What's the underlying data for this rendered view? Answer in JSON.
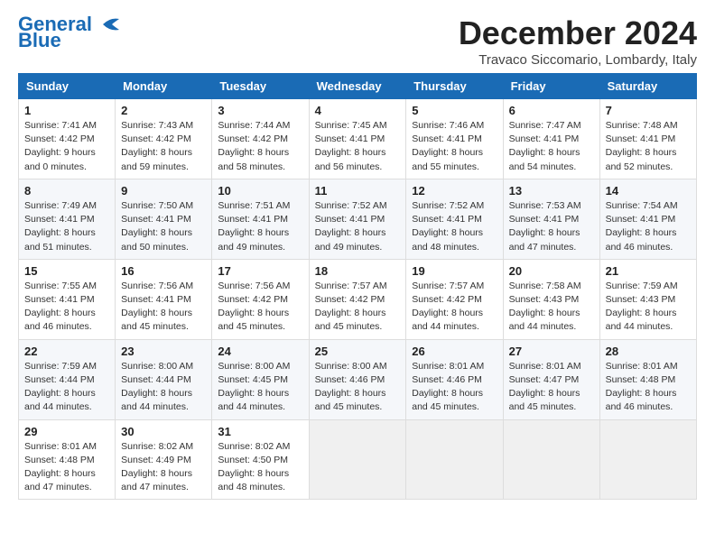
{
  "header": {
    "logo_line1": "General",
    "logo_line2": "Blue",
    "month_title": "December 2024",
    "location": "Travaco Siccomario, Lombardy, Italy"
  },
  "columns": [
    "Sunday",
    "Monday",
    "Tuesday",
    "Wednesday",
    "Thursday",
    "Friday",
    "Saturday"
  ],
  "weeks": [
    [
      {
        "day": "1",
        "sunrise": "7:41 AM",
        "sunset": "4:42 PM",
        "daylight": "9 hours and 0 minutes."
      },
      {
        "day": "2",
        "sunrise": "7:43 AM",
        "sunset": "4:42 PM",
        "daylight": "8 hours and 59 minutes."
      },
      {
        "day": "3",
        "sunrise": "7:44 AM",
        "sunset": "4:42 PM",
        "daylight": "8 hours and 58 minutes."
      },
      {
        "day": "4",
        "sunrise": "7:45 AM",
        "sunset": "4:41 PM",
        "daylight": "8 hours and 56 minutes."
      },
      {
        "day": "5",
        "sunrise": "7:46 AM",
        "sunset": "4:41 PM",
        "daylight": "8 hours and 55 minutes."
      },
      {
        "day": "6",
        "sunrise": "7:47 AM",
        "sunset": "4:41 PM",
        "daylight": "8 hours and 54 minutes."
      },
      {
        "day": "7",
        "sunrise": "7:48 AM",
        "sunset": "4:41 PM",
        "daylight": "8 hours and 52 minutes."
      }
    ],
    [
      {
        "day": "8",
        "sunrise": "7:49 AM",
        "sunset": "4:41 PM",
        "daylight": "8 hours and 51 minutes."
      },
      {
        "day": "9",
        "sunrise": "7:50 AM",
        "sunset": "4:41 PM",
        "daylight": "8 hours and 50 minutes."
      },
      {
        "day": "10",
        "sunrise": "7:51 AM",
        "sunset": "4:41 PM",
        "daylight": "8 hours and 49 minutes."
      },
      {
        "day": "11",
        "sunrise": "7:52 AM",
        "sunset": "4:41 PM",
        "daylight": "8 hours and 49 minutes."
      },
      {
        "day": "12",
        "sunrise": "7:52 AM",
        "sunset": "4:41 PM",
        "daylight": "8 hours and 48 minutes."
      },
      {
        "day": "13",
        "sunrise": "7:53 AM",
        "sunset": "4:41 PM",
        "daylight": "8 hours and 47 minutes."
      },
      {
        "day": "14",
        "sunrise": "7:54 AM",
        "sunset": "4:41 PM",
        "daylight": "8 hours and 46 minutes."
      }
    ],
    [
      {
        "day": "15",
        "sunrise": "7:55 AM",
        "sunset": "4:41 PM",
        "daylight": "8 hours and 46 minutes."
      },
      {
        "day": "16",
        "sunrise": "7:56 AM",
        "sunset": "4:41 PM",
        "daylight": "8 hours and 45 minutes."
      },
      {
        "day": "17",
        "sunrise": "7:56 AM",
        "sunset": "4:42 PM",
        "daylight": "8 hours and 45 minutes."
      },
      {
        "day": "18",
        "sunrise": "7:57 AM",
        "sunset": "4:42 PM",
        "daylight": "8 hours and 45 minutes."
      },
      {
        "day": "19",
        "sunrise": "7:57 AM",
        "sunset": "4:42 PM",
        "daylight": "8 hours and 44 minutes."
      },
      {
        "day": "20",
        "sunrise": "7:58 AM",
        "sunset": "4:43 PM",
        "daylight": "8 hours and 44 minutes."
      },
      {
        "day": "21",
        "sunrise": "7:59 AM",
        "sunset": "4:43 PM",
        "daylight": "8 hours and 44 minutes."
      }
    ],
    [
      {
        "day": "22",
        "sunrise": "7:59 AM",
        "sunset": "4:44 PM",
        "daylight": "8 hours and 44 minutes."
      },
      {
        "day": "23",
        "sunrise": "8:00 AM",
        "sunset": "4:44 PM",
        "daylight": "8 hours and 44 minutes."
      },
      {
        "day": "24",
        "sunrise": "8:00 AM",
        "sunset": "4:45 PM",
        "daylight": "8 hours and 44 minutes."
      },
      {
        "day": "25",
        "sunrise": "8:00 AM",
        "sunset": "4:46 PM",
        "daylight": "8 hours and 45 minutes."
      },
      {
        "day": "26",
        "sunrise": "8:01 AM",
        "sunset": "4:46 PM",
        "daylight": "8 hours and 45 minutes."
      },
      {
        "day": "27",
        "sunrise": "8:01 AM",
        "sunset": "4:47 PM",
        "daylight": "8 hours and 45 minutes."
      },
      {
        "day": "28",
        "sunrise": "8:01 AM",
        "sunset": "4:48 PM",
        "daylight": "8 hours and 46 minutes."
      }
    ],
    [
      {
        "day": "29",
        "sunrise": "8:01 AM",
        "sunset": "4:48 PM",
        "daylight": "8 hours and 47 minutes."
      },
      {
        "day": "30",
        "sunrise": "8:02 AM",
        "sunset": "4:49 PM",
        "daylight": "8 hours and 47 minutes."
      },
      {
        "day": "31",
        "sunrise": "8:02 AM",
        "sunset": "4:50 PM",
        "daylight": "8 hours and 48 minutes."
      },
      null,
      null,
      null,
      null
    ]
  ]
}
